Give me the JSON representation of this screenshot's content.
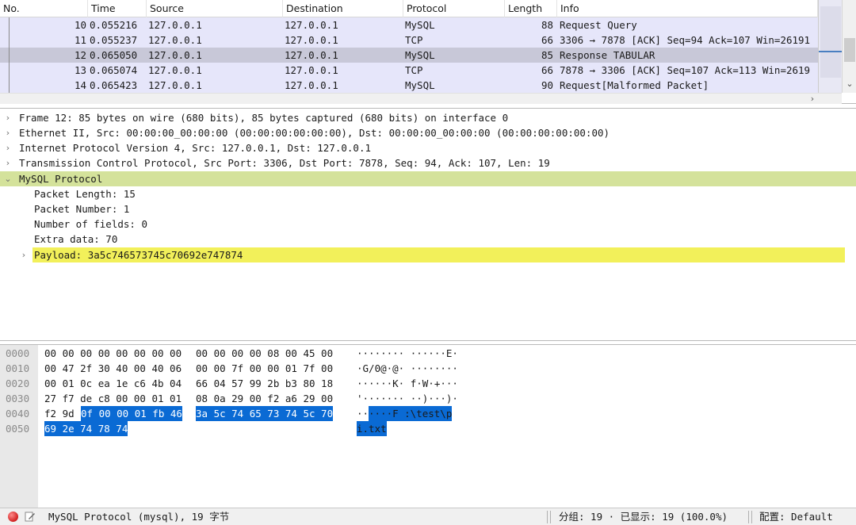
{
  "packet_list": {
    "columns": [
      "No.",
      "Time",
      "Source",
      "Destination",
      "Protocol",
      "Length",
      "Info"
    ],
    "rows": [
      {
        "no": "10",
        "time": "0.055216",
        "src": "127.0.0.1",
        "dst": "127.0.0.1",
        "proto": "MySQL",
        "len": "88",
        "info": "Request Query",
        "kind": "mysql"
      },
      {
        "no": "11",
        "time": "0.055237",
        "src": "127.0.0.1",
        "dst": "127.0.0.1",
        "proto": "TCP",
        "len": "66",
        "info": "3306 → 7878 [ACK] Seq=94 Ack=107 Win=26191",
        "kind": "tcp"
      },
      {
        "no": "12",
        "time": "0.065050",
        "src": "127.0.0.1",
        "dst": "127.0.0.1",
        "proto": "MySQL",
        "len": "85",
        "info": "Response TABULAR",
        "kind": "selected"
      },
      {
        "no": "13",
        "time": "0.065074",
        "src": "127.0.0.1",
        "dst": "127.0.0.1",
        "proto": "TCP",
        "len": "66",
        "info": "7878 → 3306 [ACK] Seq=107 Ack=113 Win=2619",
        "kind": "tcp"
      },
      {
        "no": "14",
        "time": "0.065423",
        "src": "127.0.0.1",
        "dst": "127.0.0.1",
        "proto": "MySQL",
        "len": "90",
        "info": "Request[Malformed Packet]",
        "kind": "mysql"
      }
    ]
  },
  "details": {
    "frame": "Frame 12: 85 bytes on wire (680 bits), 85 bytes captured (680 bits) on interface 0",
    "ethernet": "Ethernet II, Src: 00:00:00_00:00:00 (00:00:00:00:00:00), Dst: 00:00:00_00:00:00 (00:00:00:00:00:00)",
    "ip": "Internet Protocol Version 4, Src: 127.0.0.1, Dst: 127.0.0.1",
    "tcp": "Transmission Control Protocol, Src Port: 3306, Dst Port: 7878, Seq: 94, Ack: 107, Len: 19",
    "mysql": "MySQL Protocol",
    "packet_length": "Packet Length: 15",
    "packet_number": "Packet Number: 1",
    "num_fields": "Number of fields: 0",
    "extra_data": "Extra data: 70",
    "payload": "Payload: 3a5c746573745c70692e747874"
  },
  "hex": {
    "rows": [
      {
        "offset": "0000",
        "b1": "00 00 00 00 00 00 00 00",
        "b2": "00 00 00 00 08 00 45 00",
        "ascii": "········ ······E·"
      },
      {
        "offset": "0010",
        "b1": "00 47 2f 30 40 00 40 06",
        "b2": "00 00 7f 00 00 01 7f 00",
        "ascii": "·G/0@·@· ········"
      },
      {
        "offset": "0020",
        "b1": "00 01 0c ea 1e c6 4b 04",
        "b2": "66 04 57 99 2b b3 80 18",
        "ascii": "······K· f·W·+···"
      },
      {
        "offset": "0030",
        "b1": "27 f7 de c8 00 00 01 01",
        "b2": "08 0a 29 00 f2 a6 29 00",
        "ascii": "'······· ··)···)·"
      },
      {
        "offset": "0040",
        "b1_plain": "f2 9d ",
        "b1_sel": "0f 00 00 01 fb 46",
        "b2_sel": "3a 5c 74 65 73 74 5c 70",
        "ascii_plain": "··",
        "ascii_sel": "····F :\\test\\p"
      },
      {
        "offset": "0050",
        "b1_sel": "69 2e 74 78 74",
        "ascii_sel": "i.txt"
      }
    ]
  },
  "status": {
    "field": "MySQL Protocol (mysql), 19 字节",
    "packets": "分组: 19 · 已显示: 19 (100.0%)",
    "profile": "配置: Default"
  },
  "colors": {
    "mysql_row": "#e6e6fa",
    "selected_row": "#c8c8d8",
    "mysql_tree_highlight": "#d4e29b",
    "payload_highlight": "#f2f05a",
    "hex_selection": "#0a6ad4"
  }
}
